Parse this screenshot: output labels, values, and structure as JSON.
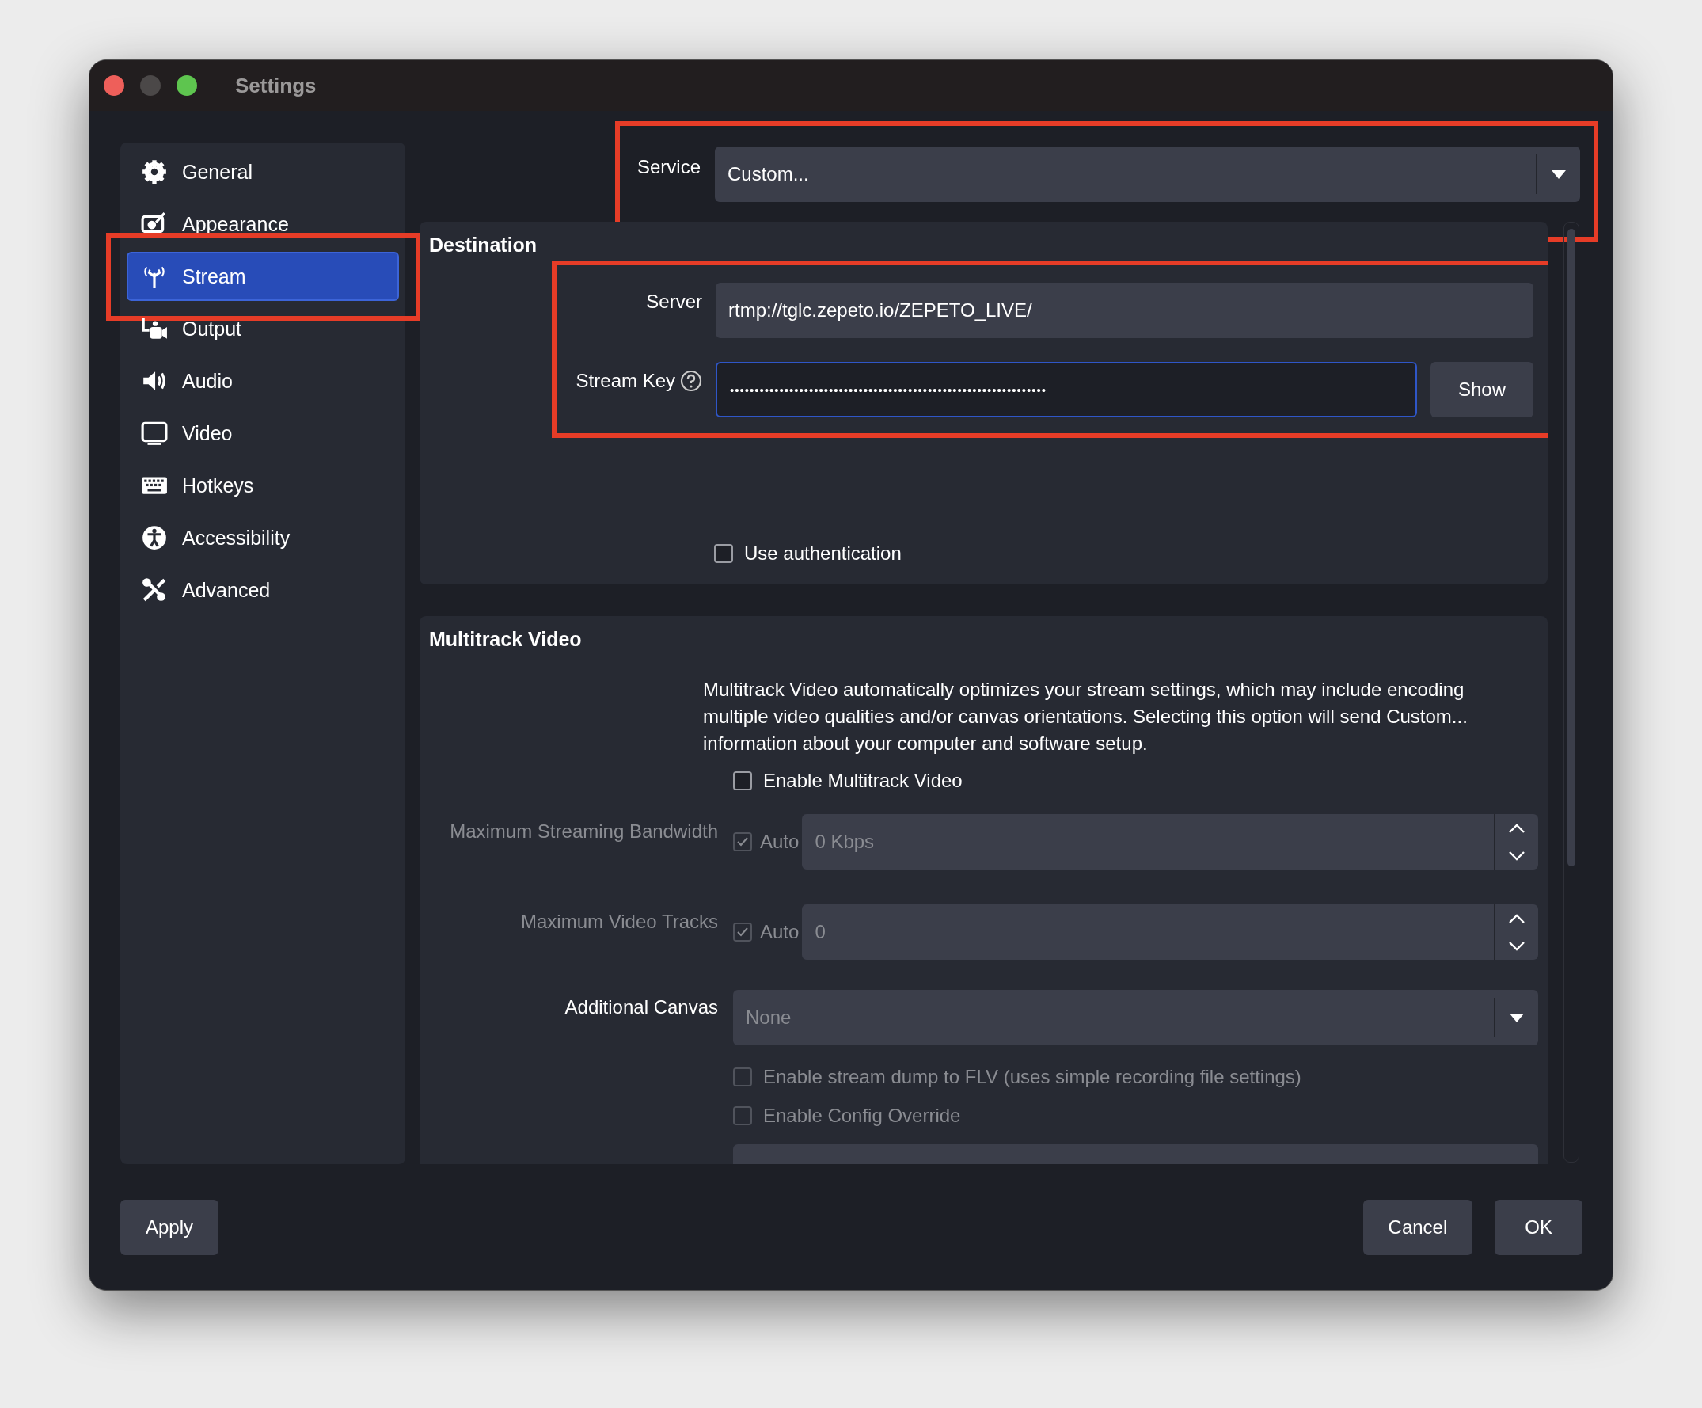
{
  "window": {
    "title": "Settings"
  },
  "sidebar": {
    "items": [
      {
        "label": "General",
        "selected": false,
        "highlighted": false
      },
      {
        "label": "Appearance",
        "selected": false,
        "highlighted": false
      },
      {
        "label": "Stream",
        "selected": true,
        "highlighted": true
      },
      {
        "label": "Output",
        "selected": false,
        "highlighted": false
      },
      {
        "label": "Audio",
        "selected": false,
        "highlighted": false
      },
      {
        "label": "Video",
        "selected": false,
        "highlighted": false
      },
      {
        "label": "Hotkeys",
        "selected": false,
        "highlighted": false
      },
      {
        "label": "Accessibility",
        "selected": false,
        "highlighted": false
      },
      {
        "label": "Advanced",
        "selected": false,
        "highlighted": false
      }
    ]
  },
  "service": {
    "label": "Service",
    "value": "Custom...",
    "highlighted": true
  },
  "destination": {
    "title": "Destination",
    "highlighted": true,
    "server": {
      "label": "Server",
      "value": "rtmp://tglc.zepeto.io/ZEPETO_LIVE/"
    },
    "stream_key": {
      "label": "Stream Key",
      "value": "••••••••••••••••••••••••••••••••••••••••••••••••••••••••••••••••",
      "focused": true
    },
    "show_button": "Show",
    "use_authentication": {
      "label": "Use authentication",
      "checked": false
    }
  },
  "multitrack": {
    "title": "Multitrack Video",
    "description": "Multitrack Video automatically optimizes your stream settings, which may include encoding multiple video qualities and/or canvas orientations. Selecting this option will send Custom... information about your computer and software setup.",
    "enable": {
      "label": "Enable Multitrack Video",
      "checked": false
    },
    "rows": [
      {
        "kind": "spin",
        "label": "Maximum Streaming Bandwidth",
        "disabled": true,
        "auto": {
          "label": "Auto",
          "checked": true
        },
        "value": "0 Kbps"
      },
      {
        "kind": "spin",
        "label": "Maximum Video Tracks",
        "disabled": true,
        "auto": {
          "label": "Auto",
          "checked": true
        },
        "value": "0"
      },
      {
        "kind": "combo",
        "label": "Additional Canvas",
        "disabled": false,
        "value": "None"
      }
    ],
    "options": [
      {
        "label": "Enable stream dump to FLV (uses simple recording file settings)",
        "checked": false,
        "disabled": true
      },
      {
        "label": "Enable Config Override",
        "checked": false,
        "disabled": true
      }
    ]
  },
  "buttons": [
    "Apply",
    "Cancel",
    "OK"
  ]
}
